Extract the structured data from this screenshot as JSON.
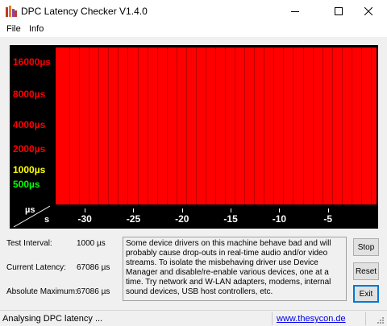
{
  "window": {
    "title": "DPC Latency Checker V1.4.0",
    "icon": "app-bars-icon",
    "minimize_icon": "minimize-icon",
    "maximize_icon": "maximize-icon",
    "close_icon": "close-icon"
  },
  "menu": {
    "file": "File",
    "info": "Info"
  },
  "chart_data": {
    "type": "bar",
    "y_scale": "log",
    "y_tick_labels": [
      "16000µs",
      "8000µs",
      "4000µs",
      "2000µs",
      "1000µs",
      "500µs"
    ],
    "y_tick_colors": [
      "#ff0000",
      "#ff0000",
      "#ff0000",
      "#ff0000",
      "#ffff00",
      "#00ff00"
    ],
    "x_unit": "s",
    "y_unit": "µs",
    "x_tick_labels": [
      "-30",
      "-25",
      "-20",
      "-15",
      "-10",
      "-5"
    ],
    "bar_color": "#ff0000",
    "x": [
      -32,
      -31,
      -30,
      -29,
      -28,
      -27,
      -26,
      -25,
      -24,
      -23,
      -22,
      -21,
      -20,
      -19,
      -18,
      -17,
      -16,
      -15,
      -14,
      -13,
      -12,
      -11,
      -10,
      -9,
      -8,
      -7,
      -6,
      -5,
      -4,
      -3,
      -2,
      -1
    ],
    "values": [
      67086,
      67086,
      67086,
      67086,
      67086,
      67086,
      67086,
      67086,
      67086,
      67086,
      67086,
      67086,
      67086,
      67086,
      67086,
      67086,
      67086,
      67086,
      67086,
      67086,
      67086,
      67086,
      67086,
      67086,
      67086,
      67086,
      67086,
      67086,
      67086,
      67086,
      67086,
      67086
    ]
  },
  "info": {
    "test_interval_label": "Test Interval:",
    "test_interval_value": "1000 µs",
    "current_latency_label": "Current Latency:",
    "current_latency_value": "67086 µs",
    "absolute_maximum_label": "Absolute Maximum:",
    "absolute_maximum_value": "67086 µs"
  },
  "message": "Some device drivers on this machine behave bad and will probably cause drop-outs in real-time audio and/or video streams. To isolate the misbehaving driver use Device Manager and disable/re-enable various devices, one at a time. Try network and W-LAN adapters, modems, internal sound devices, USB host controllers, etc.",
  "buttons": {
    "stop": "Stop",
    "reset": "Reset",
    "exit": "Exit"
  },
  "status": {
    "text": "Analysing DPC latency ...",
    "link": "www.thesycon.de",
    "grip_icon": "resize-grip-icon"
  }
}
